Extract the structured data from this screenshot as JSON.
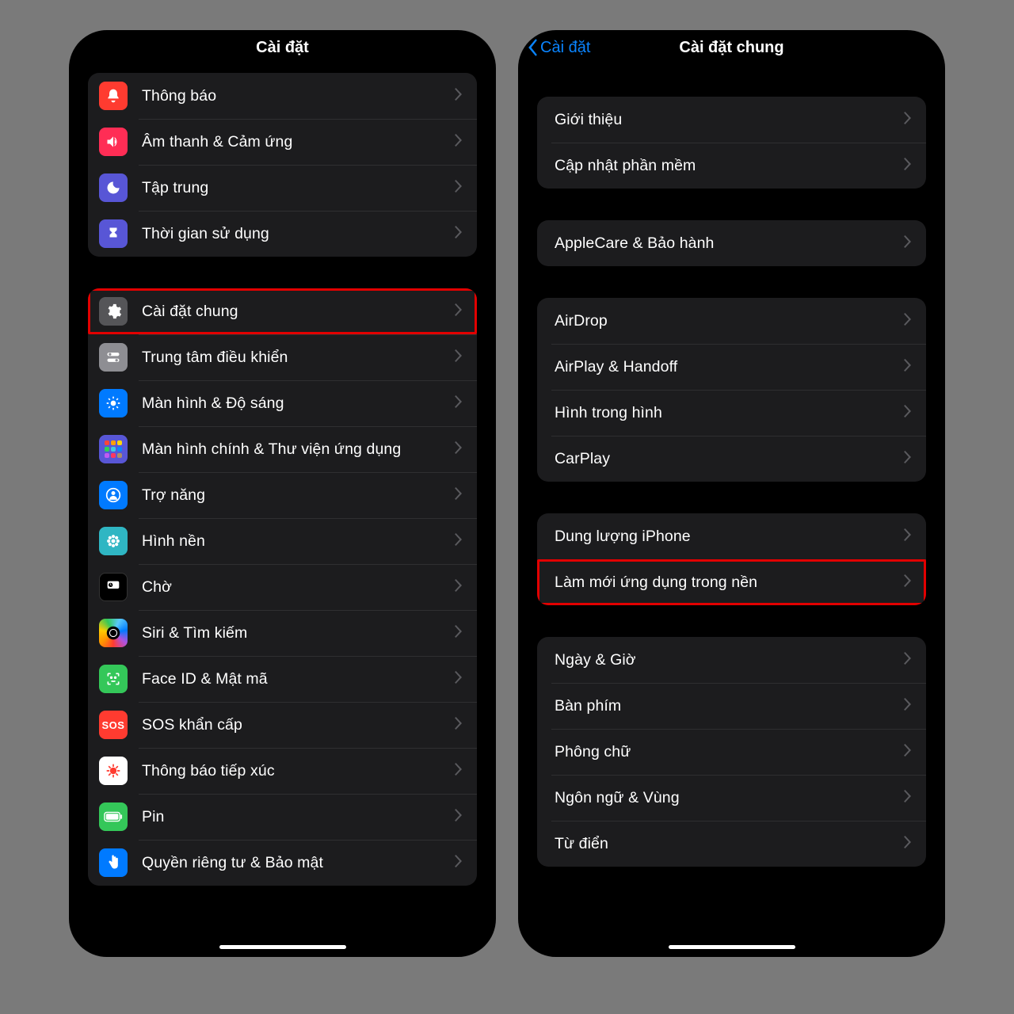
{
  "left": {
    "title": "Cài đặt",
    "groups": [
      {
        "cls": "first-left",
        "rows": [
          {
            "id": "notifications",
            "label": "Thông báo",
            "icon": "bell",
            "bg": "bg-red"
          },
          {
            "id": "sounds",
            "label": "Âm thanh & Cảm ứng",
            "icon": "speaker",
            "bg": "bg-pink"
          },
          {
            "id": "focus",
            "label": "Tập trung",
            "icon": "moon",
            "bg": "bg-indigo"
          },
          {
            "id": "screentime",
            "label": "Thời gian sử dụng",
            "icon": "hourglass",
            "bg": "bg-indigo"
          }
        ]
      },
      {
        "rows": [
          {
            "id": "general",
            "label": "Cài đặt chung",
            "icon": "gear",
            "bg": "bg-dgray",
            "highlight": true
          },
          {
            "id": "control",
            "label": "Trung tâm điều khiển",
            "icon": "switches",
            "bg": "bg-gray"
          },
          {
            "id": "display",
            "label": "Màn hình & Độ sáng",
            "icon": "sun",
            "bg": "bg-blue"
          },
          {
            "id": "home",
            "label": "Màn hình chính & Thư viện ứng dụng",
            "icon": "apps",
            "bg": "bg-apps"
          },
          {
            "id": "accessibility",
            "label": "Trợ năng",
            "icon": "person",
            "bg": "bg-blue"
          },
          {
            "id": "wallpaper",
            "label": "Hình nền",
            "icon": "flower",
            "bg": "bg-cyan"
          },
          {
            "id": "standby",
            "label": "Chờ",
            "icon": "clock",
            "bg": "bg-black"
          },
          {
            "id": "siri",
            "label": "Siri & Tìm kiếm",
            "icon": "siri",
            "bg": "bg-grad"
          },
          {
            "id": "faceid",
            "label": "Face ID & Mật mã",
            "icon": "face",
            "bg": "bg-green"
          },
          {
            "id": "sos",
            "label": "SOS khẩn cấp",
            "icon": "sos",
            "bg": "bg-sos"
          },
          {
            "id": "exposure",
            "label": "Thông báo tiếp xúc",
            "icon": "virus",
            "bg": "bg-white"
          },
          {
            "id": "battery",
            "label": "Pin",
            "icon": "battery",
            "bg": "bg-green"
          },
          {
            "id": "privacy",
            "label": "Quyền riêng tư & Bảo mật",
            "icon": "hand",
            "bg": "bg-blue"
          }
        ]
      }
    ]
  },
  "right": {
    "title": "Cài đặt chung",
    "back": "Cài đặt",
    "groups": [
      {
        "cls": "first-right",
        "rows": [
          {
            "id": "about",
            "label": "Giới thiệu"
          },
          {
            "id": "update",
            "label": "Cập nhật phần mềm"
          }
        ]
      },
      {
        "rows": [
          {
            "id": "applecare",
            "label": "AppleCare & Bảo hành"
          }
        ]
      },
      {
        "rows": [
          {
            "id": "airdrop",
            "label": "AirDrop"
          },
          {
            "id": "airplay",
            "label": "AirPlay & Handoff"
          },
          {
            "id": "pip",
            "label": "Hình trong hình"
          },
          {
            "id": "carplay",
            "label": "CarPlay"
          }
        ]
      },
      {
        "rows": [
          {
            "id": "storage",
            "label": "Dung lượng iPhone"
          },
          {
            "id": "bgrefresh",
            "label": "Làm mới ứng dụng trong nền",
            "highlight": true
          }
        ]
      },
      {
        "rows": [
          {
            "id": "datetime",
            "label": "Ngày & Giờ"
          },
          {
            "id": "keyboard",
            "label": "Bàn phím"
          },
          {
            "id": "fonts",
            "label": "Phông chữ"
          },
          {
            "id": "language",
            "label": "Ngôn ngữ & Vùng"
          },
          {
            "id": "dictionary",
            "label": "Từ điển"
          }
        ]
      }
    ]
  }
}
